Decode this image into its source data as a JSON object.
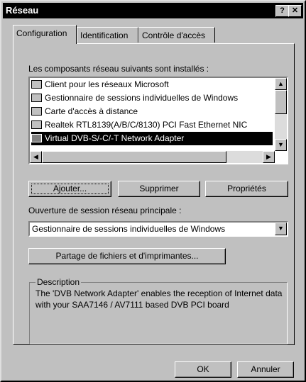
{
  "window": {
    "title": "Réseau",
    "help_label": "?",
    "close_label": "✕"
  },
  "tabs": [
    {
      "label": "Configuration"
    },
    {
      "label": "Identification"
    },
    {
      "label": "Contrôle d'accès"
    }
  ],
  "components": {
    "label": "Les composants réseau suivants sont installés :",
    "items": [
      {
        "label": "Client pour les réseaux Microsoft",
        "icon": "network-client-icon"
      },
      {
        "label": "Gestionnaire de sessions individuelles de Windows",
        "icon": "network-client-icon"
      },
      {
        "label": "Carte d'accès à distance",
        "icon": "network-adapter-icon"
      },
      {
        "label": "Realtek RTL8139(A/B/C/8130) PCI Fast Ethernet NIC",
        "icon": "network-adapter-icon"
      },
      {
        "label": "Virtual DVB-S/-C/-T Network Adapter",
        "icon": "network-adapter-icon",
        "selected": true
      }
    ]
  },
  "buttons": {
    "add": "Ajouter...",
    "remove": "Supprimer",
    "properties": "Propriétés"
  },
  "logon": {
    "label": "Ouverture de session réseau principale :",
    "value": "Gestionnaire de sessions individuelles de Windows"
  },
  "file_sharing_button": "Partage de fichiers et d'imprimantes...",
  "description": {
    "legend": "Description",
    "text": "The 'DVB Network Adapter' enables the reception of Internet data with your  SAA7146 / AV7111 based DVB PCI board"
  },
  "footer": {
    "ok": "OK",
    "cancel": "Annuler"
  }
}
